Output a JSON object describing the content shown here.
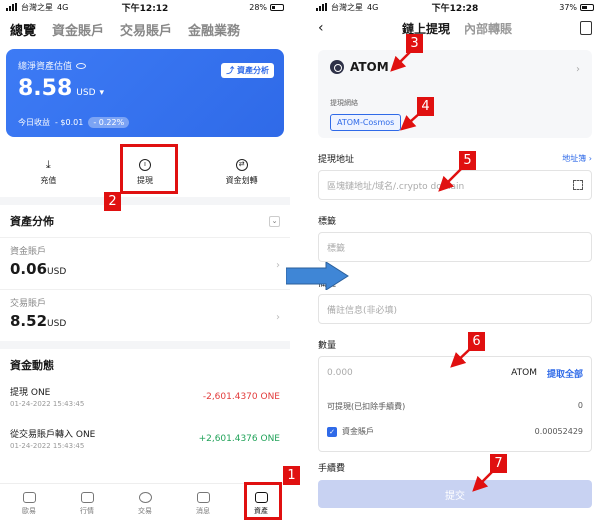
{
  "status_left": {
    "carrier": "台灣之星",
    "net": "4G",
    "time": "下午12:12",
    "battery": "28%"
  },
  "status_right": {
    "carrier": "台灣之星",
    "net": "4G",
    "time": "下午12:28",
    "battery": "37%"
  },
  "left": {
    "nav": [
      "總覽",
      "資金賬戶",
      "交易賬戶",
      "金融業務"
    ],
    "card": {
      "label": "總淨資產估值",
      "value": "8.58",
      "unit": "USD",
      "pnl_label": "今日收益",
      "pnl_value": "- $0.01",
      "pnl_pct": "- 0.22%",
      "analysis": "資產分析"
    },
    "actions": [
      "充值",
      "提現",
      "資金划轉"
    ],
    "dist_title": "資產分佈",
    "accounts": [
      {
        "name": "資金賬戶",
        "amount": "0.06",
        "unit": "USD"
      },
      {
        "name": "交易賬戶",
        "amount": "8.52",
        "unit": "USD"
      }
    ],
    "flow_title": "資金動態",
    "transactions": [
      {
        "title": "提現 ONE",
        "date": "01-24-2022 15:43:45",
        "amount": "-2,601.4370 ONE",
        "type": "neg"
      },
      {
        "title": "從交易賬戶轉入 ONE",
        "date": "01-24-2022 15:43:45",
        "amount": "+2,601.4376 ONE",
        "type": "pos"
      }
    ],
    "tabs": [
      "歐易",
      "行情",
      "交易",
      "消息",
      "資產"
    ]
  },
  "right": {
    "tabs": [
      "鏈上提現",
      "內部轉賬"
    ],
    "coin": "ATOM",
    "network_label": "提現網絡",
    "network": "ATOM-Cosmos",
    "address_label": "提現地址",
    "address_book": "地址簿",
    "address_placeholder": "區塊鏈地址/域名/.crypto domain",
    "tag_label": "標籤",
    "tag_placeholder": "標籤",
    "memo_label": "備註",
    "memo_placeholder": "備註信息(非必填)",
    "qty_label": "數量",
    "qty_placeholder": "0.000",
    "qty_unit": "ATOM",
    "withdraw_all": "提取全部",
    "available_label": "可提現(已扣除手續費)",
    "available_value": "0",
    "fund_account": "資金賬戶",
    "fund_value": "0.00052429",
    "fee_label": "手續費",
    "submit": "提交"
  },
  "badges": [
    "1",
    "2",
    "3",
    "4",
    "5",
    "6",
    "7"
  ],
  "colors": {
    "brand": "#2f6ae8",
    "annotation": "#e01010",
    "negative": "#e23b3b",
    "positive": "#22a35a"
  }
}
